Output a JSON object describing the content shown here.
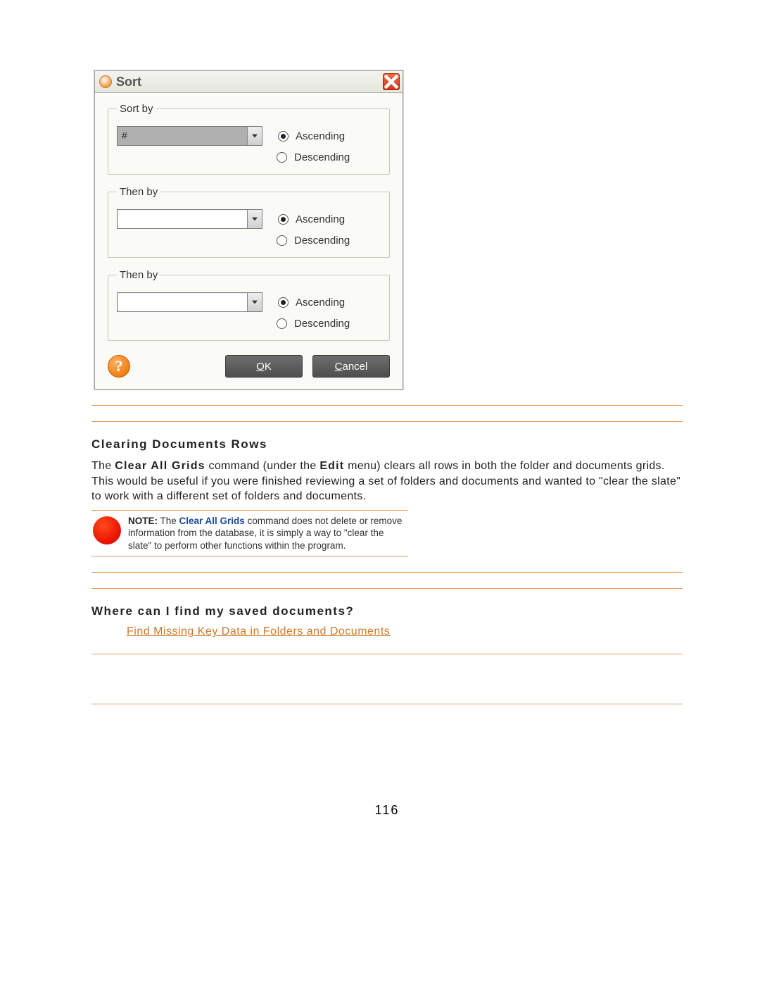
{
  "dialog": {
    "title": "Sort",
    "groups": [
      {
        "legend": "Sort by",
        "value": "#",
        "highlighted": true,
        "asc": "Ascending",
        "desc": "Descending",
        "selected": "asc"
      },
      {
        "legend": "Then by",
        "value": "",
        "highlighted": false,
        "asc": "Ascending",
        "desc": "Descending",
        "selected": "asc"
      },
      {
        "legend": "Then by",
        "value": "",
        "highlighted": false,
        "asc": "Ascending",
        "desc": "Descending",
        "selected": "asc"
      }
    ],
    "ok_underline": "O",
    "ok_rest": "K",
    "cancel_underline": "C",
    "cancel_rest": "ancel",
    "help": "?"
  },
  "section1": {
    "title": "Clearing Documents Rows",
    "para_pre": "The ",
    "para_b1": "Clear All Grids",
    "para_mid1": " command (under the ",
    "para_b2": "Edit",
    "para_post": " menu) clears all rows in both the folder and documents grids. This would be useful if you were finished reviewing a set of folders and documents and wanted to \"clear the slate\" to work with a different set of folders and documents."
  },
  "note": {
    "label": "NOTE:",
    "pre": " The ",
    "blue": "Clear All Grids",
    "post": " command does not delete or remove information from the database, it is simply a way to \"clear the slate\" to perform other functions within the program."
  },
  "section2": {
    "title": "Where can I find my saved documents?",
    "link": "Find Missing Key Data in Folders and Documents"
  },
  "page_number": "116"
}
